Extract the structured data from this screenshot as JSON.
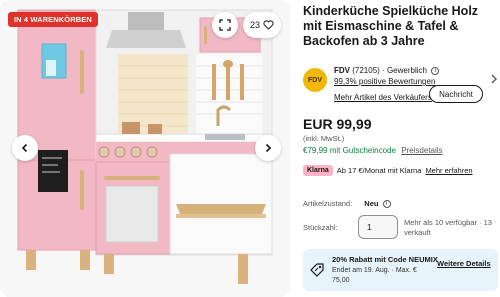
{
  "gallery": {
    "badge": "IN 4 WARENKÖRBEN",
    "watch_count": "23",
    "icons": [
      "expand-icon",
      "heart-icon",
      "chevron-left-icon",
      "chevron-right-icon"
    ]
  },
  "product": {
    "title": "Kinderküche Spielküche Holz mit Eismaschine & Tafel & Backofen ab 3 Jahre"
  },
  "seller": {
    "name": "FDV",
    "ratings": "(72105)",
    "type": "Gewerblich",
    "feedback": "99,3% positive Bewertungen",
    "more_items": "Mehr Artikel des Verkäufers",
    "contact_label": "Nachricht",
    "logo_text": "FDV"
  },
  "pricing": {
    "price": "EUR 99,99",
    "vat_note": "(inkl. MwSt.)",
    "coupon_price": "€79,99 mit Gutscheincode",
    "price_details": "Preisdetails"
  },
  "klarna": {
    "logo": "Klarna",
    "text": "Ab 17 €/Monat mit Klarna",
    "more": "Mehr erfahren"
  },
  "condition": {
    "label": "Artikelzustand:",
    "value": "Neu"
  },
  "quantity": {
    "label": "Stückzahl:",
    "value": "1",
    "availability": "Mehr als 10 verfügbar · 13 verkauft"
  },
  "promo": {
    "title": "20% Rabatt mit Code NEUMIX",
    "subtitle": "Endet am 19. Aug. · Max. € 75,00",
    "link": "Weitere Details"
  },
  "colors": {
    "badge": "#e0312a",
    "promo_bg": "#e6f3fb",
    "coupon_green": "#0a7f3e",
    "klarna_pink": "#ffb3c7",
    "kitchen_pink": "#f2b6c4"
  }
}
